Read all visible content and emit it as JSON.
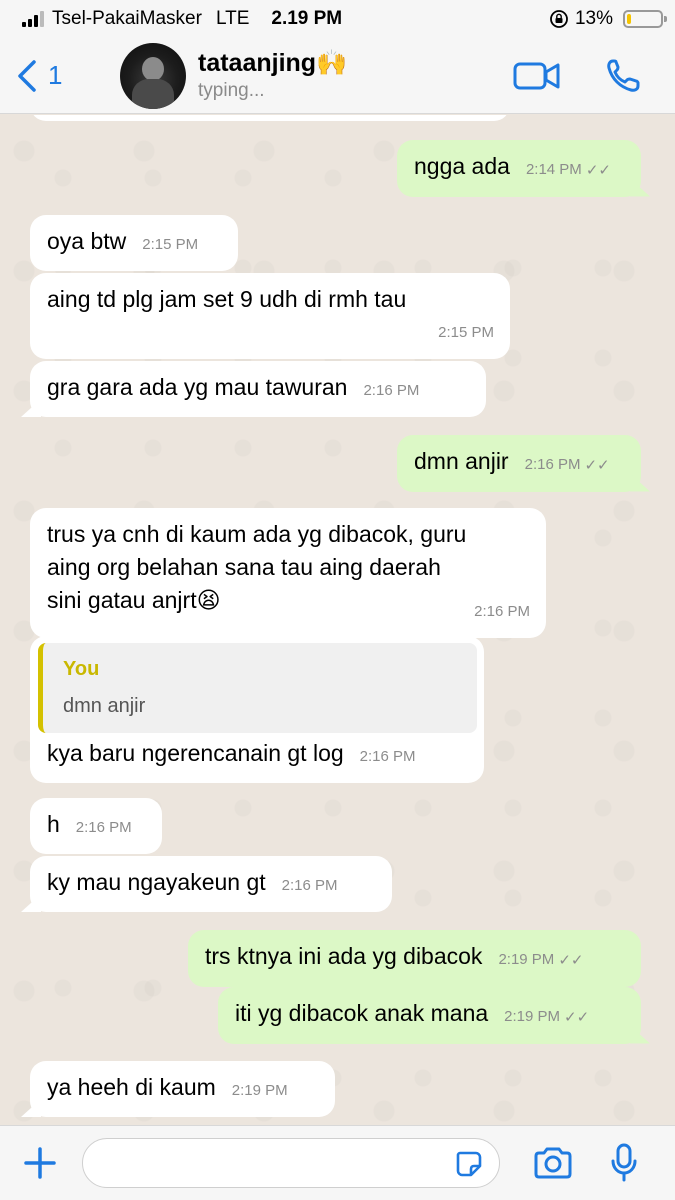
{
  "status_bar": {
    "carrier": "Tsel-PakaiMasker",
    "network": "LTE",
    "time": "2.19 PM",
    "battery": "13%",
    "battery_level": 0.13
  },
  "header": {
    "back_count": "1",
    "contact_name": "tataanjing🙌",
    "contact_status": "typing..."
  },
  "messages": [
    {
      "text": "ngga ada",
      "time": "2:14 PM",
      "dir": "out",
      "ticks": "✓✓"
    },
    {
      "text": "oya btw",
      "time": "2:15 PM",
      "dir": "in"
    },
    {
      "text": "aing td plg jam set 9 udh di rmh tau",
      "time": "2:15 PM",
      "dir": "in"
    },
    {
      "text": "gra gara ada yg mau tawuran",
      "time": "2:16 PM",
      "dir": "in"
    },
    {
      "text": "dmn anjir",
      "time": "2:16 PM",
      "dir": "out",
      "ticks": "✓✓"
    },
    {
      "text": "trus ya cnh di kaum ada yg dibacok, guru\naing org belahan sana tau aing daerah\nsini gatau anjrt😫",
      "time": "2:16 PM",
      "dir": "in"
    },
    {
      "reply_author": "You",
      "reply_text": "dmn anjir",
      "text": "kya baru ngerencanain gt log",
      "time": "2:16 PM",
      "dir": "in"
    },
    {
      "text": "h",
      "time": "2:16 PM",
      "dir": "in"
    },
    {
      "text": "ky mau ngayakeun gt",
      "time": "2:16 PM",
      "dir": "in"
    },
    {
      "text": "trs ktnya ini ada yg dibacok",
      "time": "2:19 PM",
      "dir": "out",
      "ticks": "✓✓"
    },
    {
      "text": "iti yg dibacok anak mana",
      "time": "2:19 PM",
      "dir": "out",
      "ticks": "✓✓"
    },
    {
      "text": "ya heeh di kaum",
      "time": "2:19 PM",
      "dir": "in"
    }
  ],
  "icons": {
    "back": "chevron-left-icon",
    "video": "video-camera-icon",
    "call": "phone-icon",
    "add": "plus-icon",
    "sticker": "sticker-icon",
    "camera": "camera-icon",
    "mic": "microphone-icon"
  },
  "colors": {
    "accent": "#1f7ae0",
    "outgoing_bubble": "#dcf8c6",
    "incoming_bubble": "#ffffff",
    "chat_background": "#ece5dd",
    "reply_accent": "#d4c100"
  }
}
